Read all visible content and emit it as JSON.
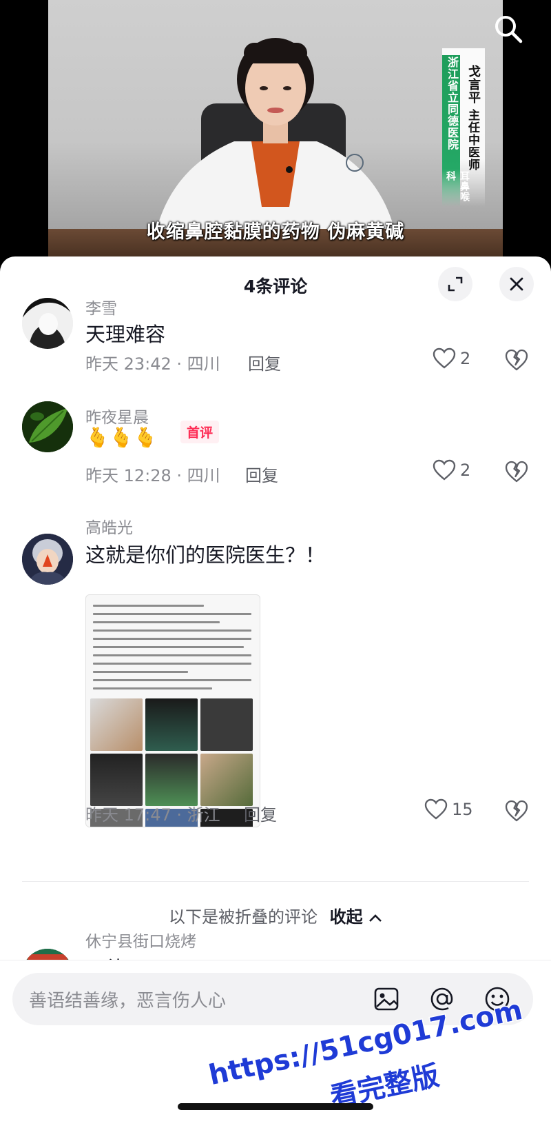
{
  "video": {
    "subtitle": "收缩鼻腔黏膜的药物 伪麻黄碱",
    "banner": {
      "hospital": "浙江省立同德医院",
      "department": "耳鼻喉科",
      "doctor": "戈言平",
      "title": "主任中医师"
    }
  },
  "panel": {
    "title": "4条评论"
  },
  "comments": [
    {
      "author": "李雪",
      "text": "天理难容",
      "time_location": "昨天 23:42 · 四川",
      "reply_label": "回复",
      "likes": "2"
    },
    {
      "author": "昨夜星晨",
      "text": "🫰🫰🫰",
      "badge": "首评",
      "time_location": "昨天 12:28 · 四川",
      "reply_label": "回复",
      "likes": "2"
    },
    {
      "author": "高皓光",
      "text": "这就是你们的医院医生？！",
      "time_location": "昨天 17:47 · 浙江",
      "reply_label": "回复",
      "likes": "15"
    }
  ],
  "folded": {
    "label": "以下是被折叠的评论",
    "toggle": "收起"
  },
  "folded_comments": [
    {
      "author": "休宁县街口烧烤",
      "text": "无德"
    }
  ],
  "input": {
    "placeholder": "善语结善缘，恶言伤人心"
  },
  "watermark": {
    "line1": "https://51cg017.com",
    "line2": "看完整版"
  },
  "colors": {
    "accent": "#fe2c55",
    "banner_green": "#25a866",
    "watermark_blue": "#1f3bd6"
  }
}
